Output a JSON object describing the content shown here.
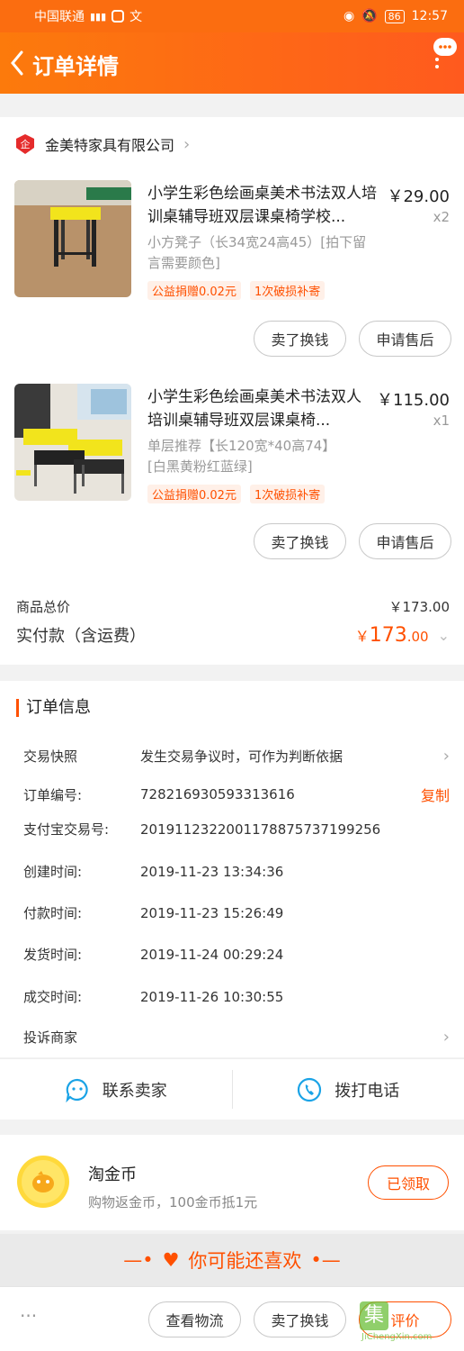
{
  "status": {
    "carrier": "中国联通",
    "signal": "46​",
    "battery": "86",
    "time": "12:57"
  },
  "header": {
    "title": "订单详情"
  },
  "shop": {
    "name": "金美特家具有限公司"
  },
  "items": [
    {
      "title": "小学生彩色绘画桌美术书法双人培训桌辅导班双层课桌椅学校...",
      "price": "￥29.00",
      "qty": "x2",
      "spec": "小方凳子（长34宽24高45）[拍下留言需要颜色]",
      "tags": [
        "公益捐赠0.02元",
        "1次破损补寄"
      ],
      "btn1": "卖了换钱",
      "btn2": "申请售后"
    },
    {
      "title": "小学生彩色绘画桌美术书法双人培训桌辅导班双层课桌椅...",
      "price": "￥115.00",
      "qty": "x1",
      "spec": "单层推荐【长120宽*40高74】[白黑黄粉红蓝绿]",
      "tags": [
        "公益捐赠0.02元",
        "1次破损补寄"
      ],
      "btn1": "卖了换钱",
      "btn2": "申请售后"
    }
  ],
  "totals": {
    "goods_label": "商品总价",
    "goods_value": "￥173.00",
    "paid_label": "实付款（含运费）",
    "paid_currency": "￥",
    "paid_int": "173",
    "paid_dec": ".00"
  },
  "order_info": {
    "title": "订单信息",
    "snapshot_label": "交易快照",
    "snapshot_value": "发生交易争议时，可作为判断依据",
    "rows": [
      {
        "k": "订单编号:",
        "v": "728216930593313616"
      },
      {
        "k": "支付宝交易号:",
        "v": "2019112322001178875737199256"
      },
      {
        "k": "创建时间:",
        "v": "2019-11-23 13:34:36"
      },
      {
        "k": "付款时间:",
        "v": "2019-11-23 15:26:49"
      },
      {
        "k": "发货时间:",
        "v": "2019-11-24 00:29:24"
      },
      {
        "k": "成交时间:",
        "v": "2019-11-26 10:30:55"
      }
    ],
    "copy": "复制",
    "complain": "投诉商家"
  },
  "contact": {
    "seller": "联系卖家",
    "phone": "拨打电话"
  },
  "coin": {
    "title": "淘金币",
    "desc": "购物返金币，100金币抵1元",
    "btn": "已领取"
  },
  "like": {
    "text": "你可能还喜欢"
  },
  "bottom": {
    "more": "···",
    "logistics": "查看物流",
    "sell": "卖了换钱",
    "review": "评价"
  },
  "watermark": "JiChengXin.com",
  "colors": {
    "accent": "#ff5000",
    "header": "#fc7a0c"
  }
}
